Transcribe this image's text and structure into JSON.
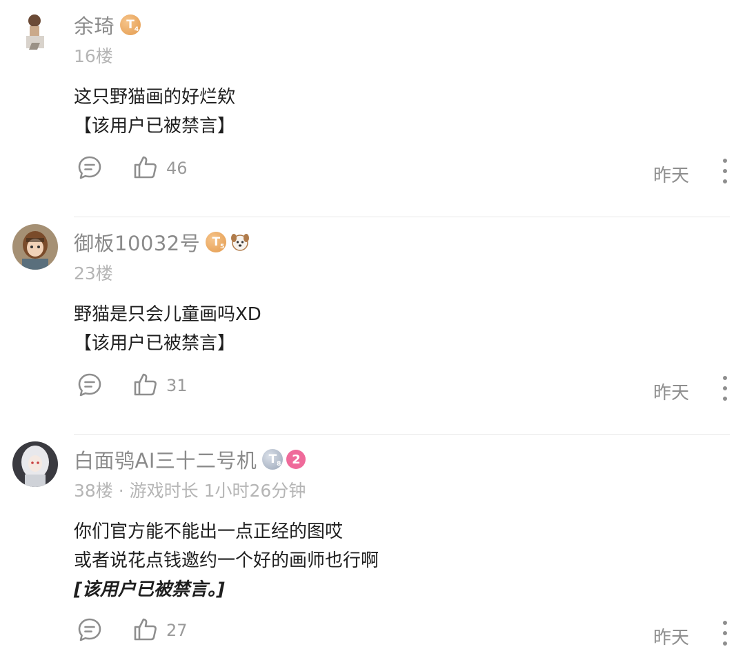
{
  "comments": [
    {
      "username": "余琦",
      "badges": [
        {
          "type": "level",
          "text": "T",
          "sub": "4",
          "color": "gold"
        }
      ],
      "meta": "16楼",
      "lines": [
        "这只野猫画的好烂欸",
        "【该用户已被禁言】"
      ],
      "likes": "46",
      "time": "昨天"
    },
    {
      "username": "御板10032号",
      "badges": [
        {
          "type": "level",
          "text": "T",
          "sub": "5",
          "color": "gold"
        },
        {
          "type": "pet",
          "icon": "dog-face-icon"
        }
      ],
      "meta": "23楼",
      "lines": [
        "野猫是只会儿童画吗XD",
        "【该用户已被禁言】"
      ],
      "likes": "31",
      "time": "昨天"
    },
    {
      "username": "白面鸮AI三十二号机",
      "badges": [
        {
          "type": "level",
          "text": "T",
          "sub": "8",
          "color": "silver"
        },
        {
          "type": "number",
          "text": "2",
          "color": "#ef6a9a"
        }
      ],
      "meta": "38楼 · 游戏时长 1小时26分钟",
      "lines": [
        "你们官方能不能出一点正经的图哎",
        "或者说花点钱邀约一个好的画师也行啊",
        "[该用户已被禁言。]"
      ],
      "likes": "27",
      "time": "昨天"
    }
  ]
}
